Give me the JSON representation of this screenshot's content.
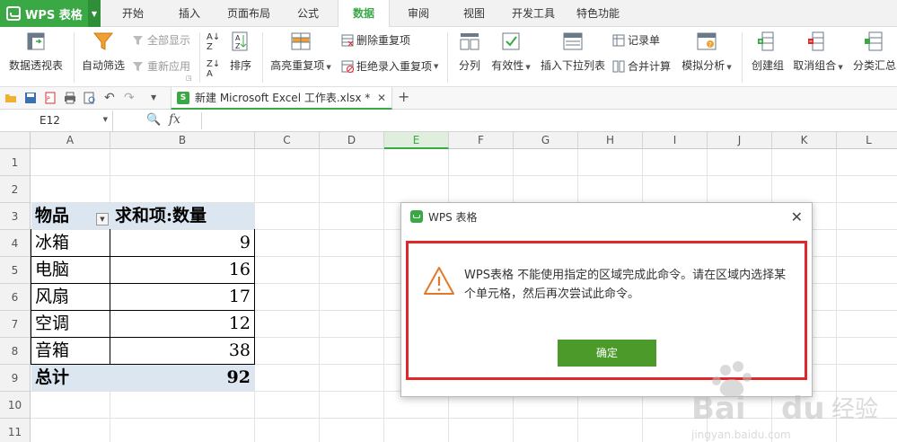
{
  "app": {
    "title": "WPS 表格"
  },
  "menu_tabs": [
    {
      "label": "开始"
    },
    {
      "label": "插入"
    },
    {
      "label": "页面布局"
    },
    {
      "label": "公式"
    },
    {
      "label": "数据"
    },
    {
      "label": "审阅"
    },
    {
      "label": "视图"
    },
    {
      "label": "开发工具"
    },
    {
      "label": "特色功能"
    }
  ],
  "active_tab": "数据",
  "ribbon": {
    "pivot": "数据透视表",
    "autofilter": "自动筛选",
    "show_all": "全部显示",
    "reapply": "重新应用",
    "sort": "排序",
    "highlight_dup": "高亮重复项",
    "remove_dup": "删除重复项",
    "reject_dup": "拒绝录入重复项",
    "split": "分列",
    "validity": "有效性",
    "dropdown": "插入下拉列表",
    "record": "记录单",
    "consolidate": "合并计算",
    "whatif": "模拟分析",
    "group": "创建组",
    "ungroup": "取消组合",
    "subtotal": "分类汇总"
  },
  "doc_tab": {
    "name": "新建 Microsoft Excel 工作表.xlsx *"
  },
  "namebox": {
    "value": "E12"
  },
  "formula_bar": {
    "fx": "fx"
  },
  "columns": [
    "A",
    "B",
    "C",
    "D",
    "E",
    "F",
    "G",
    "H",
    "I",
    "J",
    "K",
    "L"
  ],
  "selected_column": "E",
  "rows": [
    "1",
    "2",
    "3",
    "4",
    "5",
    "6",
    "7",
    "8",
    "9",
    "10",
    "11"
  ],
  "pivot": {
    "header": [
      "物品",
      "求和项:数量"
    ],
    "items": [
      {
        "name": "冰箱",
        "value": "9"
      },
      {
        "name": "电脑",
        "value": "16"
      },
      {
        "name": "风扇",
        "value": "17"
      },
      {
        "name": "空调",
        "value": "12"
      },
      {
        "name": "音箱",
        "value": "38"
      }
    ],
    "total": {
      "name": "总计",
      "value": "92"
    }
  },
  "dialog": {
    "title": "WPS 表格",
    "message": "WPS表格 不能使用指定的区域完成此命令。请在区域内选择某个单元格，然后再次尝试此命令。",
    "ok_label": "确定"
  },
  "watermark": {
    "brand": "Baidu",
    "cn": "经验",
    "url": "jingyan.baidu.com"
  },
  "colors": {
    "accent": "#39a845",
    "ok_button": "#4c9a2a",
    "highlight_frame": "#e0282a",
    "pivot_fill": "#dce6f1"
  }
}
